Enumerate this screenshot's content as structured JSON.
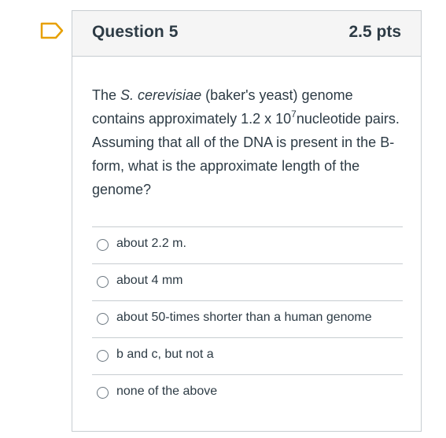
{
  "question": {
    "title": "Question 5",
    "points": "2.5 pts",
    "text_part1": "The ",
    "text_italic": "S. cerevisiae",
    "text_part2": " (baker's yeast) genome contains approximately 1.2 x 10",
    "text_superscript": "7",
    "text_part3": "nucleotide pairs.  Assuming that all of the DNA is present in the B-form, what is the approximate length of the genome?",
    "flag_icon": "flag-icon"
  },
  "answers": [
    {
      "label": "about 2.2 m.",
      "selected": false
    },
    {
      "label": "about 4 mm",
      "selected": false
    },
    {
      "label": "about 50-times shorter than a human genome",
      "selected": false
    },
    {
      "label": "b and c, but not a",
      "selected": false
    },
    {
      "label": "none of the above",
      "selected": false
    }
  ],
  "colors": {
    "text": "#2d3b45",
    "border": "#c7cdd1",
    "header_bg": "#f5f5f5",
    "flag_accent": "#e7a000"
  }
}
